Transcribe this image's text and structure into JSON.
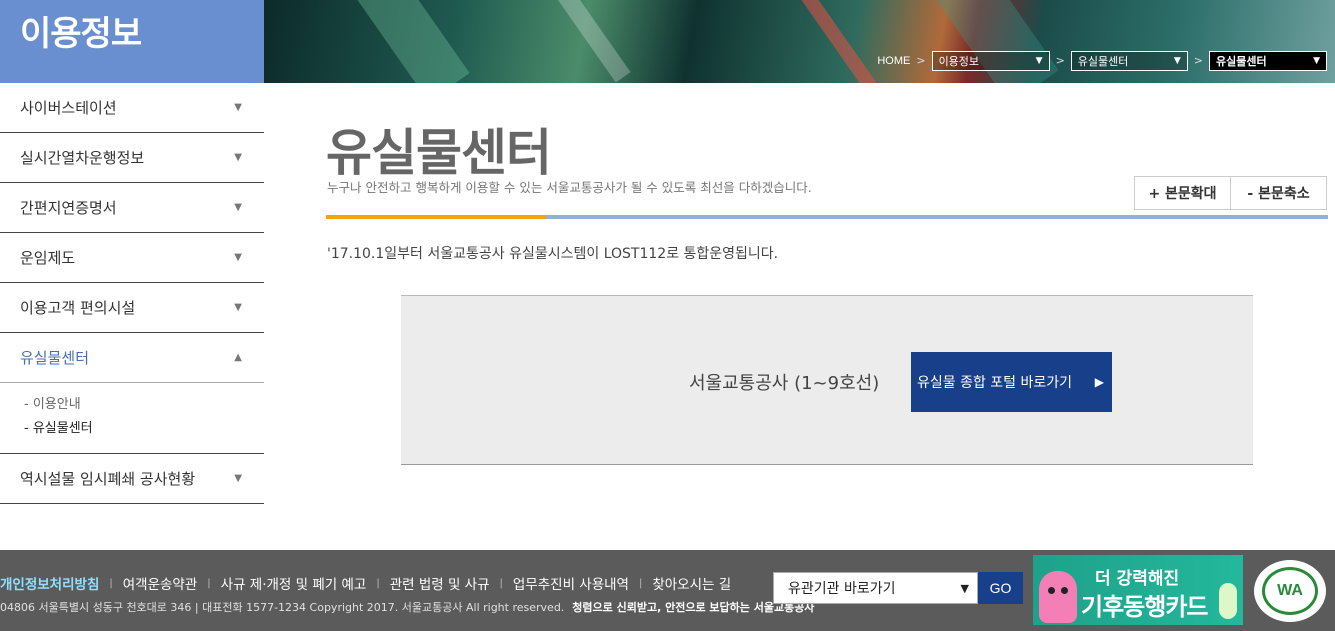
{
  "header": {
    "title": "이용정보",
    "breadcrumb": {
      "home": "HOME",
      "level1": "이용정보",
      "level2": "유실물센터",
      "level3": "유실물센터"
    }
  },
  "sidebar": {
    "items": [
      {
        "label": "사이버스테이션"
      },
      {
        "label": "실시간열차운행정보"
      },
      {
        "label": "간편지연증명서"
      },
      {
        "label": "운임제도"
      },
      {
        "label": "이용고객 편의시설"
      },
      {
        "label": "유실물센터"
      },
      {
        "label": "역시설물 임시폐쇄 공사현황"
      }
    ],
    "submenu": [
      {
        "label": "이용안내"
      },
      {
        "label": "유실물센터"
      }
    ]
  },
  "main": {
    "title": "유실물센터",
    "description": "누구나 안전하고 행복하게 이용할 수 있는 서울교통공사가 될 수 있도록 최선을 다하겠습니다.",
    "zoom_in": "+ 본문확대",
    "zoom_out": "- 본문축소",
    "notice": "'17.10.1일부터 서울교통공사 유실물시스템이 LOST112로 통합운영됩니다.",
    "org_label": "서울교통공사 (1~9호선)",
    "portal_button": "유실물 종합 포털 바로가기"
  },
  "footer": {
    "links": [
      "개인정보처리방침",
      "여객운송약관",
      "사규 제·개정 및 폐기 예고",
      "관련 법령 및 사규",
      "업무추진비 사용내역",
      "찾아오시는 길"
    ],
    "address": "04806 서울특별시 성동구 천호대로 346 | 대표전화 1577-1234 Copyright 2017. 서울교통공사 All right reserved.",
    "slogan": "청렴으로 신뢰받고, 안전으로 보답하는 서울교통공사",
    "org_select": "유관기관 바로가기",
    "go_label": "GO",
    "card_line1": "더 강력해진",
    "card_line2": "기후동행카드",
    "wa_mark": "WA"
  },
  "colors": {
    "header_blue": "#6a8fd0",
    "accent_navy": "#173f8a",
    "title_line": "#8fb3d6",
    "title_accent": "#f0a500"
  },
  "icons": {
    "caret_down": "chevron-down-icon",
    "caret_up": "chevron-up-icon",
    "play": "play-icon"
  }
}
